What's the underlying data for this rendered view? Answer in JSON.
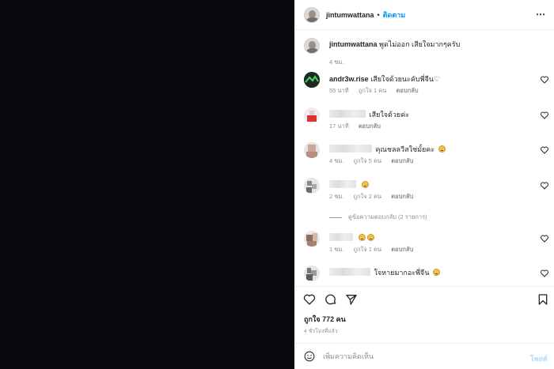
{
  "post_author": "jintumwattana",
  "header": {
    "dot": "•",
    "follow_label": "ติดตาม",
    "more_icon": "more-horizontal-icon"
  },
  "caption": {
    "username": "jintumwattana",
    "text": "พูดไม่ออก เสียใจมากๆครับ",
    "time": "4 ชม."
  },
  "comments": [
    {
      "username": "andr3w.rise",
      "text": "เสียใจด้วยนะคับพี่จีน♡",
      "time": "55 นาที",
      "likes": "ถูกใจ 1 คน",
      "reply": "ตอบกลับ"
    },
    {
      "username": "",
      "text": "เสียใจด้วยค่ะ",
      "time": "17 นาที",
      "likes": "",
      "reply": "ตอบกลับ"
    },
    {
      "username": "",
      "text": "คุณชลลวีสใช่มั้ยคะ",
      "time": "4 ชม.",
      "likes": "ถูกใจ 5 คน",
      "reply": "ตอบกลับ"
    },
    {
      "username": "",
      "text": "",
      "time": "2 ชม.",
      "likes": "ถูกใจ 2 คน",
      "reply": "ตอบกลับ"
    },
    {
      "username": "",
      "text": "",
      "time": "1 ชม.",
      "likes": "ถูกใจ 1 คน",
      "reply": "ตอบกลับ"
    },
    {
      "username": "",
      "text": "ใจหายมากอะพี่จีน",
      "time": "",
      "likes": "",
      "reply": ""
    }
  ],
  "view_replies": "ดูข้อความตอบกลับ (2 รายการ)",
  "actions": {
    "like_icon": "heart-icon",
    "comment_icon": "comment-icon",
    "share_icon": "send-icon",
    "save_icon": "bookmark-icon"
  },
  "likes_count": "ถูกใจ 772 คน",
  "posted_ago": "4 ชั่วโมงที่แล้ว",
  "compose": {
    "placeholder": "เพิ่มความคิดเห็น",
    "post_label": "โพสต์",
    "emoji_icon": "smile-icon"
  }
}
